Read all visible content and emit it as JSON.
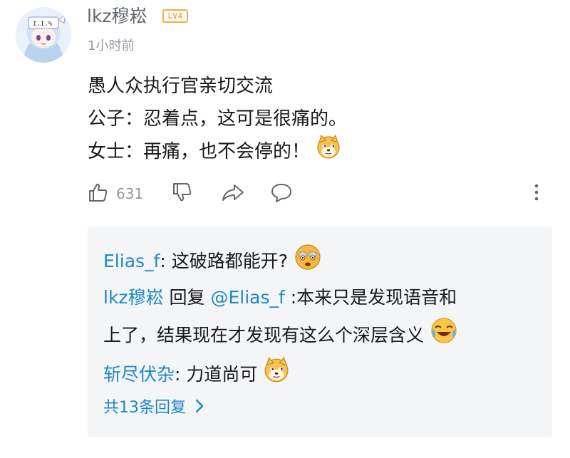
{
  "comment": {
    "username": "lkz穆崧",
    "level": "LV4",
    "time": "1小时前",
    "lines": [
      "愚人众执行官亲切交流",
      "公子：忍着点，这可是很痛的。",
      "女士：再痛，也不会停的！"
    ],
    "emoji": "doge-emoji",
    "likes": "631"
  },
  "replies": [
    {
      "user": "Elias_f",
      "sep": ": ",
      "text": "这破路都能开?",
      "emoji": "old-face-emoji"
    },
    {
      "user": "lkz穆崧",
      "mid": " 回复 ",
      "target": "@Elias_f",
      "sep": " :",
      "text": "本来只是发现语音和",
      "text2": "上了，结果现在才发现有这么个深层含义",
      "emoji": "laugh-cry-emoji"
    },
    {
      "user": "斩尽伏杂",
      "sep": ": ",
      "text": "力道尚可",
      "emoji": "doge-emoji"
    }
  ],
  "more_replies": "共13条回复",
  "colors": {
    "link": "#1e88c8",
    "muted": "#9499a0",
    "badge": "#ffa742",
    "reply_bg": "#f4f5f7"
  }
}
